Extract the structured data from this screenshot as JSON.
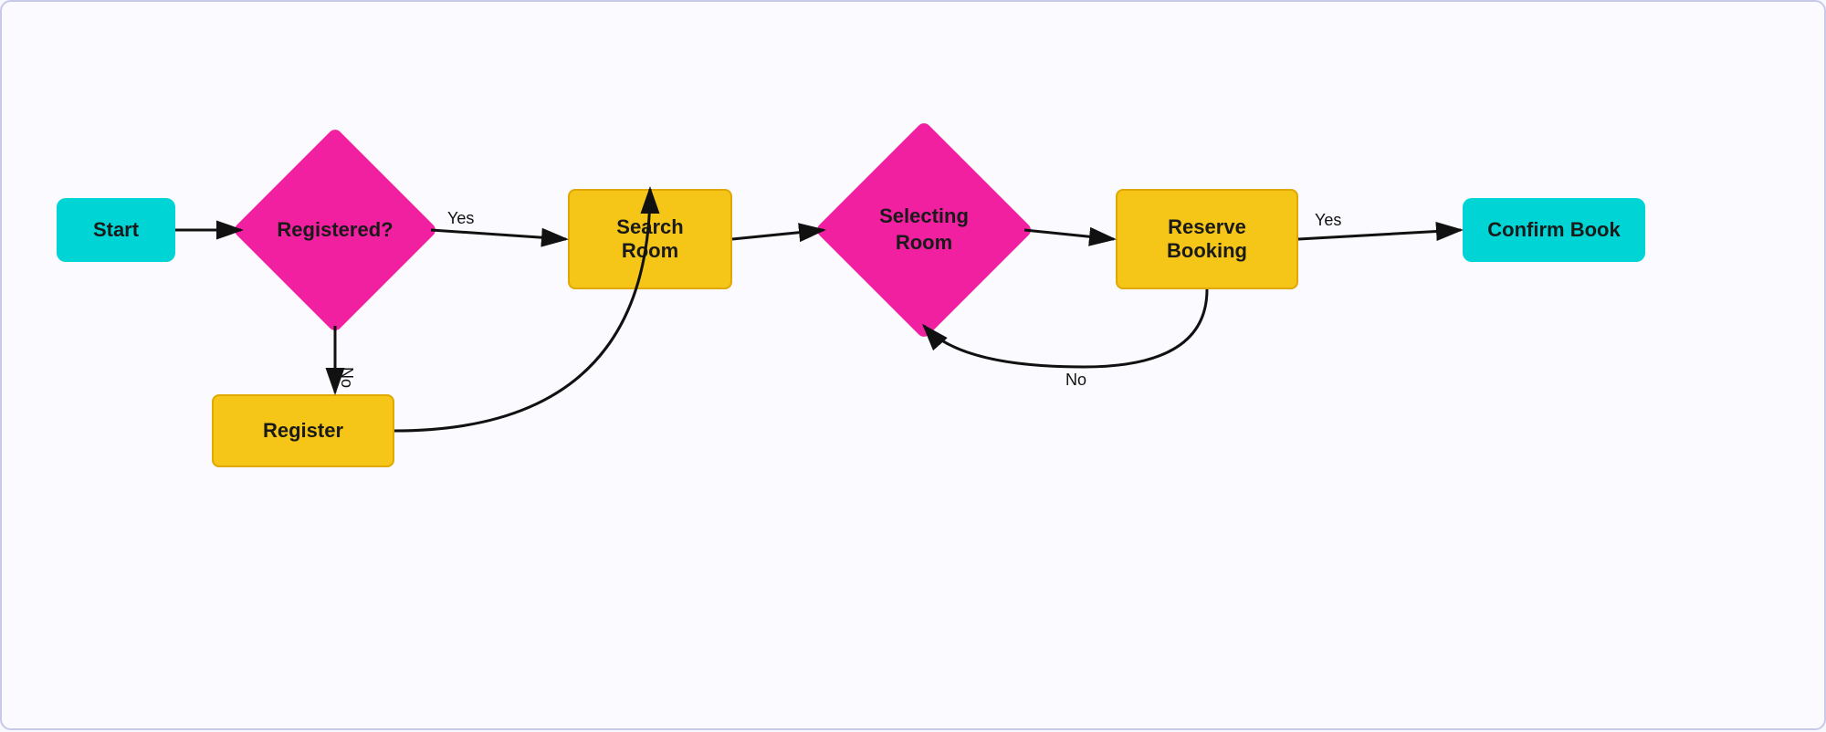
{
  "nodes": {
    "start": {
      "label": "Start"
    },
    "registered": {
      "label": "Registered?"
    },
    "search_room": {
      "label": "Search\nRoom"
    },
    "selecting_room": {
      "label": "Selecting\nRoom"
    },
    "reserve_booking": {
      "label": "Reserve\nBooking"
    },
    "confirm_book": {
      "label": "Confirm\nBook"
    },
    "register": {
      "label": "Register"
    }
  },
  "labels": {
    "yes1": "Yes",
    "no1": "No",
    "yes2": "Yes",
    "no2": "No"
  },
  "colors": {
    "cyan": "#00d4d4",
    "yellow": "#f5c518",
    "pink": "#f020a0",
    "arrow": "#111111"
  }
}
